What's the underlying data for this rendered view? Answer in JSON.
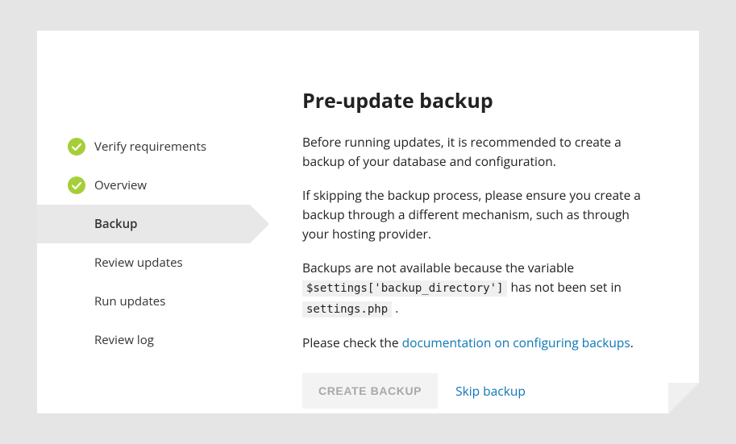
{
  "sidebar": {
    "steps": [
      {
        "label": "Verify requirements",
        "status": "done"
      },
      {
        "label": "Overview",
        "status": "done"
      },
      {
        "label": "Backup",
        "status": "active"
      },
      {
        "label": "Review updates",
        "status": "pending"
      },
      {
        "label": "Run updates",
        "status": "pending"
      },
      {
        "label": "Review log",
        "status": "pending"
      }
    ]
  },
  "main": {
    "title": "Pre-update backup",
    "para1": "Before running updates, it is recommended to create a backup of your database and configuration.",
    "para2": "If skipping the backup process, please ensure you create a backup through a different mechanism, such as through your hosting provider.",
    "para3_pre": "Backups are not available because the variable ",
    "para3_code1": "$settings['backup_directory']",
    "para3_mid": " has not been set in ",
    "para3_code2": "settings.php",
    "para3_post": ".",
    "para4_pre": "Please check the ",
    "para4_link": "documentation on configuring backups",
    "para4_post": ".",
    "create_button": "CREATE BACKUP",
    "skip_link": "Skip backup"
  }
}
